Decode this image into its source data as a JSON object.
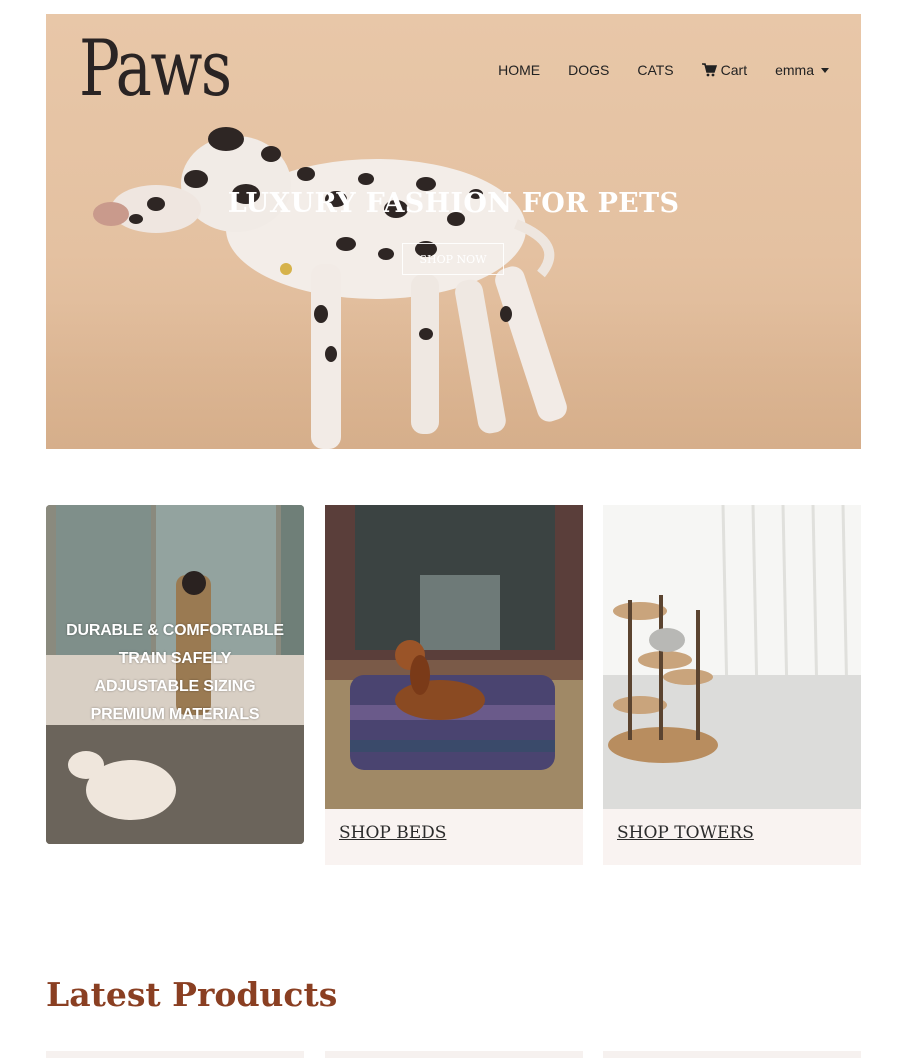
{
  "header": {
    "logo": "Paws",
    "nav": {
      "home": "HOME",
      "dogs": "DOGS",
      "cats": "CATS",
      "cart": "Cart",
      "user": "emma"
    }
  },
  "hero": {
    "title": "LUXURY FASHION FOR PETS",
    "button": "SHOP NOW"
  },
  "cards": {
    "features": {
      "lines": [
        "DURABLE & COMFORTABLE",
        "TRAIN SAFELY",
        "ADJUSTABLE SIZING",
        "PREMIUM MATERIALS"
      ]
    },
    "beds": {
      "label": "SHOP BEDS"
    },
    "towers": {
      "label": "SHOP TOWERS"
    }
  },
  "latest": {
    "title": "Latest Products"
  },
  "colors": {
    "hero_bg": "#e6c4a5",
    "accent_title": "#8a3f22",
    "card_bg": "#f9f3f1"
  },
  "icons": {
    "cart": "cart-icon",
    "user_menu": "caret-down-icon"
  }
}
